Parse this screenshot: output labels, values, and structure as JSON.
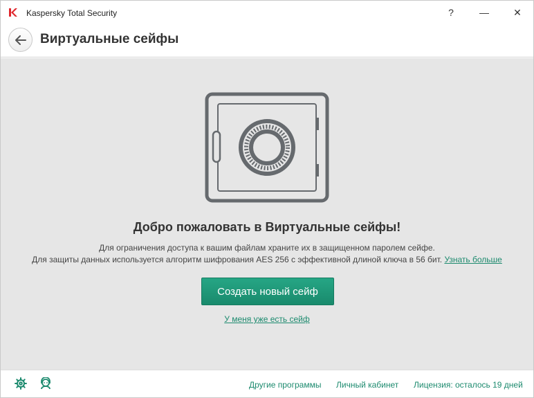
{
  "window": {
    "title": "Kaspersky Total Security",
    "help_symbol": "?",
    "minimize_symbol": "—",
    "close_symbol": "✕"
  },
  "header": {
    "title": "Виртуальные сейфы"
  },
  "main": {
    "welcome": "Добро пожаловать в Виртуальные сейфы!",
    "desc_line1": "Для ограничения доступа к вашим файлам храните их в защищенном паролем сейфе.",
    "desc_line2": "Для защиты данных используется алгоритм шифрования AES 256 с эффективной длиной ключа в 56 бит.",
    "learn_more": "Узнать больше",
    "create_button": "Создать новый сейф",
    "have_safe_link": "У меня уже есть сейф"
  },
  "footer": {
    "other_programs": "Другие программы",
    "personal_cabinet": "Личный кабинет",
    "license": "Лицензия: осталось 19 дней"
  },
  "colors": {
    "accent": "#1c8a6e",
    "button": "#198a6c",
    "logo_red": "#e0262c",
    "content_bg": "#e6e6e6",
    "illustration": "#666a6e"
  },
  "icons": {
    "logo": "kaspersky-k-icon",
    "back": "arrow-left-icon",
    "safe": "safe-icon",
    "settings": "gear-icon",
    "support": "support-agent-icon"
  }
}
